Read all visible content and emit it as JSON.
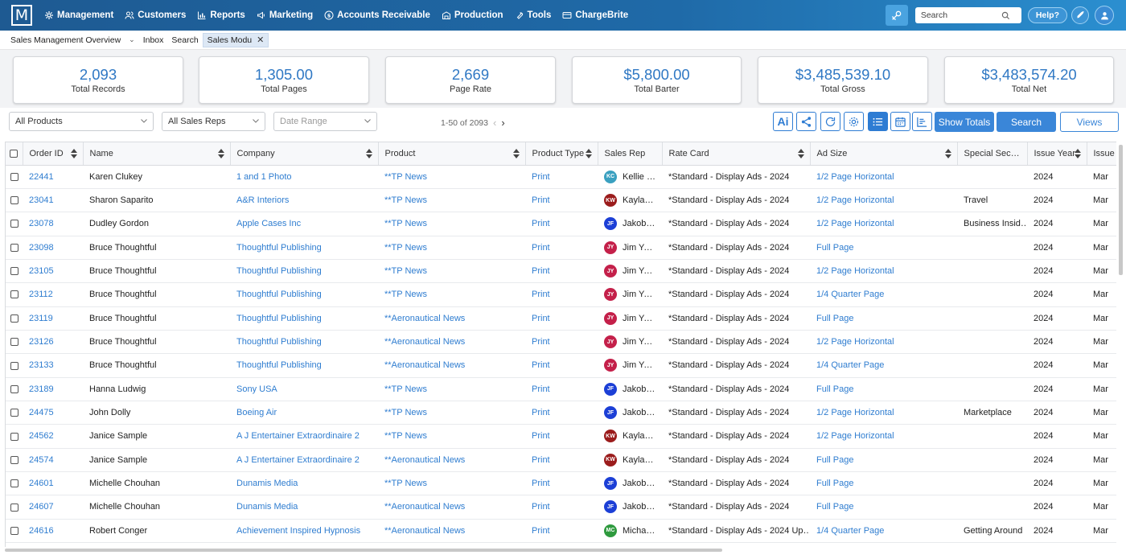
{
  "app": {
    "logo_letter": "M",
    "nav": [
      {
        "label": "Management",
        "icon": "gear-icon"
      },
      {
        "label": "Customers",
        "icon": "users-icon"
      },
      {
        "label": "Reports",
        "icon": "bar-chart-icon"
      },
      {
        "label": "Marketing",
        "icon": "megaphone-icon"
      },
      {
        "label": "Accounts Receivable",
        "icon": "dollar-circle-icon"
      },
      {
        "label": "Production",
        "icon": "building-icon"
      },
      {
        "label": "Tools",
        "icon": "wrench-icon"
      },
      {
        "label": "ChargeBrite",
        "icon": "card-icon"
      }
    ],
    "search_placeholder": "Search",
    "help_label": "Help?",
    "brand_color": "#1f6aa8",
    "accent_color": "#2f7dd0"
  },
  "tabs": [
    {
      "label": "Sales Management Overview",
      "active": false
    },
    {
      "label": "Inbox",
      "active": false
    },
    {
      "label": "Search",
      "active": false
    },
    {
      "label": "Sales Modu",
      "active": true
    }
  ],
  "stats": [
    {
      "value": "2,093",
      "label": "Total Records"
    },
    {
      "value": "1,305.00",
      "label": "Total Pages"
    },
    {
      "value": "2,669",
      "label": "Page Rate"
    },
    {
      "value": "$5,800.00",
      "label": "Total Barter"
    },
    {
      "value": "$3,485,539.10",
      "label": "Total Gross"
    },
    {
      "value": "$3,483,574.20",
      "label": "Total Net"
    }
  ],
  "filters": {
    "products": "All Products",
    "sales_reps": "All Sales Reps",
    "date_range_placeholder": "Date Range",
    "pager": "1-50 of 2093"
  },
  "toolbar": {
    "ai_label": "Ai",
    "show_totals": "Show Totals",
    "search": "Search",
    "views": "Views"
  },
  "table": {
    "columns": [
      "Order ID",
      "Name",
      "Company",
      "Product",
      "Product Type",
      "Sales Rep",
      "Rate Card",
      "Ad Size",
      "Special Sec…",
      "Issue Year",
      "Issue"
    ],
    "rows": [
      {
        "id": "22441",
        "name": "Karen Clukey",
        "company": "1 and 1 Photo",
        "product": "**TP News",
        "type": "Print",
        "initials": "KC",
        "rep": "Kellie C…",
        "rate": "*Standard - Display Ads - 2024",
        "size": "1/2 Page Horizontal",
        "section": "",
        "year": "2024",
        "issue": "Mar"
      },
      {
        "id": "23041",
        "name": "Sharon Saparito",
        "company": "A&R Interiors",
        "product": "**TP News",
        "type": "Print",
        "initials": "KW",
        "rep": "Kayla W…",
        "rate": "*Standard - Display Ads - 2024",
        "size": "1/2 Page Horizontal",
        "section": "Travel",
        "year": "2024",
        "issue": "Mar"
      },
      {
        "id": "23078",
        "name": "Dudley Gordon",
        "company": "Apple Cases Inc",
        "product": "**TP News",
        "type": "Print",
        "initials": "JF",
        "rep": "Jakob F…",
        "rate": "*Standard - Display Ads - 2024",
        "size": "1/2 Page Horizontal",
        "section": "Business Insid…",
        "year": "2024",
        "issue": "Mar"
      },
      {
        "id": "23098",
        "name": "Bruce Thoughtful",
        "company": "Thoughtful Publishing",
        "product": "**TP News",
        "type": "Print",
        "initials": "JY",
        "rep": "Jim You…",
        "rate": "*Standard - Display Ads - 2024",
        "size": "Full Page",
        "section": "",
        "year": "2024",
        "issue": "Mar"
      },
      {
        "id": "23105",
        "name": "Bruce Thoughtful",
        "company": "Thoughtful Publishing",
        "product": "**TP News",
        "type": "Print",
        "initials": "JY",
        "rep": "Jim You…",
        "rate": "*Standard - Display Ads - 2024",
        "size": "1/2 Page Horizontal",
        "section": "",
        "year": "2024",
        "issue": "Mar"
      },
      {
        "id": "23112",
        "name": "Bruce Thoughtful",
        "company": "Thoughtful Publishing",
        "product": "**TP News",
        "type": "Print",
        "initials": "JY",
        "rep": "Jim You…",
        "rate": "*Standard - Display Ads - 2024",
        "size": "1/4 Quarter Page",
        "section": "",
        "year": "2024",
        "issue": "Mar"
      },
      {
        "id": "23119",
        "name": "Bruce Thoughtful",
        "company": "Thoughtful Publishing",
        "product": "**Aeronautical News",
        "type": "Print",
        "initials": "JY",
        "rep": "Jim You…",
        "rate": "*Standard - Display Ads - 2024",
        "size": "Full Page",
        "section": "",
        "year": "2024",
        "issue": "Mar"
      },
      {
        "id": "23126",
        "name": "Bruce Thoughtful",
        "company": "Thoughtful Publishing",
        "product": "**Aeronautical News",
        "type": "Print",
        "initials": "JY",
        "rep": "Jim You…",
        "rate": "*Standard - Display Ads - 2024",
        "size": "1/2 Page Horizontal",
        "section": "",
        "year": "2024",
        "issue": "Mar"
      },
      {
        "id": "23133",
        "name": "Bruce Thoughtful",
        "company": "Thoughtful Publishing",
        "product": "**Aeronautical News",
        "type": "Print",
        "initials": "JY",
        "rep": "Jim You…",
        "rate": "*Standard - Display Ads - 2024",
        "size": "1/4 Quarter Page",
        "section": "",
        "year": "2024",
        "issue": "Mar"
      },
      {
        "id": "23189",
        "name": "Hanna Ludwig",
        "company": "Sony USA",
        "product": "**TP News",
        "type": "Print",
        "initials": "JF",
        "rep": "Jakob F…",
        "rate": "*Standard - Display Ads - 2024",
        "size": "Full Page",
        "section": "",
        "year": "2024",
        "issue": "Mar"
      },
      {
        "id": "24475",
        "name": "John Dolly",
        "company": "Boeing Air",
        "product": "**TP News",
        "type": "Print",
        "initials": "JF",
        "rep": "Jakob F…",
        "rate": "*Standard - Display Ads - 2024",
        "size": "1/2 Page Horizontal",
        "section": "Marketplace",
        "year": "2024",
        "issue": "Mar"
      },
      {
        "id": "24562",
        "name": "Janice Sample",
        "company": "A J Entertainer Extraordinaire 2",
        "product": "**TP News",
        "type": "Print",
        "initials": "KW",
        "rep": "Kayla W…",
        "rate": "*Standard - Display Ads - 2024",
        "size": "1/2 Page Horizontal",
        "section": "",
        "year": "2024",
        "issue": "Mar"
      },
      {
        "id": "24574",
        "name": "Janice Sample",
        "company": "A J Entertainer Extraordinaire 2",
        "product": "**Aeronautical News",
        "type": "Print",
        "initials": "KW",
        "rep": "Kayla W…",
        "rate": "*Standard - Display Ads - 2024",
        "size": "Full Page",
        "section": "",
        "year": "2024",
        "issue": "Mar"
      },
      {
        "id": "24601",
        "name": "Michelle Chouhan",
        "company": "Dunamis Media",
        "product": "**TP News",
        "type": "Print",
        "initials": "JF",
        "rep": "Jakob F…",
        "rate": "*Standard - Display Ads - 2024",
        "size": "Full Page",
        "section": "",
        "year": "2024",
        "issue": "Mar"
      },
      {
        "id": "24607",
        "name": "Michelle Chouhan",
        "company": "Dunamis Media",
        "product": "**Aeronautical News",
        "type": "Print",
        "initials": "JF",
        "rep": "Jakob F…",
        "rate": "*Standard - Display Ads - 2024",
        "size": "Full Page",
        "section": "",
        "year": "2024",
        "issue": "Mar"
      },
      {
        "id": "24616",
        "name": "Robert Conger",
        "company": "Achievement Inspired Hypnosis",
        "product": "**Aeronautical News",
        "type": "Print",
        "initials": "MC",
        "rep": "Michael…",
        "rate": "*Standard - Display Ads - 2024 Up…",
        "size": "1/4 Quarter Page",
        "section": "Getting Around",
        "year": "2024",
        "issue": "Mar"
      }
    ]
  },
  "avatar_colors": {
    "KC": "#3aa0c0",
    "KW": "#9b1c1c",
    "JF": "#1c3fd6",
    "JY": "#c4204a",
    "MC": "#2e9a3e"
  }
}
